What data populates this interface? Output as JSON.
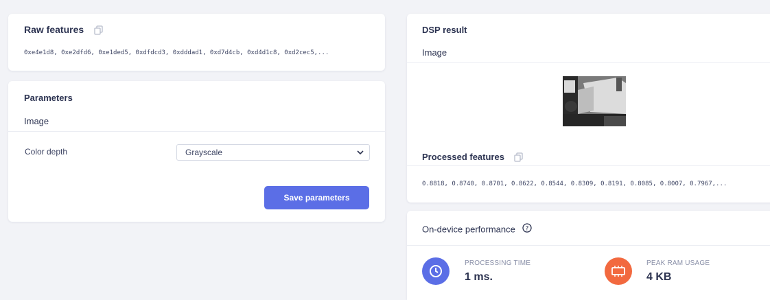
{
  "raw_features": {
    "title": "Raw features",
    "values": "0xe4e1d8, 0xe2dfd6, 0xe1ded5, 0xdfdcd3, 0xdddad1, 0xd7d4cb, 0xd4d1c8, 0xd2cec5,..."
  },
  "parameters": {
    "title": "Parameters",
    "section": "Image",
    "color_depth_label": "Color depth",
    "color_depth_value": "Grayscale",
    "save_label": "Save parameters"
  },
  "dsp_result": {
    "title": "DSP result",
    "section": "Image",
    "processed_title": "Processed features",
    "processed_values": "0.8818, 0.8740, 0.8701, 0.8622, 0.8544, 0.8309, 0.8191, 0.8085, 0.8007, 0.7967,..."
  },
  "performance": {
    "title": "On-device performance",
    "processing_time_label": "PROCESSING TIME",
    "processing_time_value": "1 ms.",
    "peak_ram_label": "PEAK RAM USAGE",
    "peak_ram_value": "4 KB",
    "colors": {
      "time": "#5b6ee6",
      "ram": "#f2693f"
    }
  },
  "icons": [
    "copy-icon",
    "help-circle-icon",
    "chevron-down-icon",
    "clock-icon",
    "memory-chip-icon"
  ]
}
